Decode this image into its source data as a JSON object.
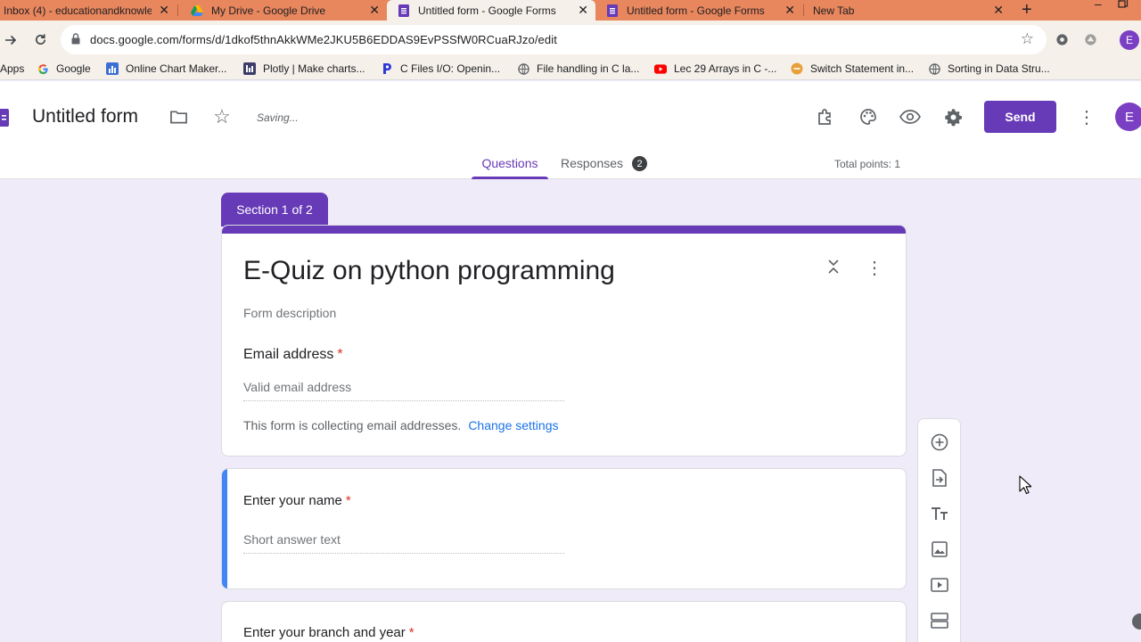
{
  "browser": {
    "tabs": [
      {
        "title": "Inbox (4) - educationandknowle",
        "icon": "gmail-icon"
      },
      {
        "title": "My Drive - Google Drive",
        "icon": "drive-icon"
      },
      {
        "title": "Untitled form - Google Forms",
        "icon": "forms-icon",
        "active": true
      },
      {
        "title": "Untitled form - Google Forms",
        "icon": "forms-icon"
      },
      {
        "title": "New Tab",
        "icon": ""
      }
    ],
    "url": "docs.google.com/forms/d/1dkof5thnAkkWMe2JKU5B6EDDAS9EvPSSfW0RCuaRJzo/edit",
    "bookmarks": [
      {
        "label": "Apps",
        "icon": "apps-grid-icon"
      },
      {
        "label": "Google",
        "icon": "google-icon"
      },
      {
        "label": "Online Chart Maker...",
        "icon": "chart-maker-icon"
      },
      {
        "label": "Plotly | Make charts...",
        "icon": "plotly-icon"
      },
      {
        "label": "C Files I/O: Openin...",
        "icon": "programiz-icon"
      },
      {
        "label": "File handling in C la...",
        "icon": "globe-icon"
      },
      {
        "label": "Lec 29 Arrays in C -...",
        "icon": "youtube-icon"
      },
      {
        "label": "Switch Statement in...",
        "icon": "gfg-icon"
      },
      {
        "label": "Sorting in Data Stru...",
        "icon": "globe-icon"
      }
    ],
    "profile_initial": "E"
  },
  "forms_header": {
    "doc_title": "Untitled form",
    "status": "Saving...",
    "send_label": "Send",
    "avatar_initial": "E",
    "tabs": {
      "questions": "Questions",
      "responses": "Responses",
      "responses_count": "2"
    },
    "total_points": "Total points: 1"
  },
  "section": {
    "tag": "Section 1 of 2",
    "title": "E-Quiz on python programming",
    "description_placeholder": "Form description"
  },
  "email_question": {
    "label": "Email address",
    "required_mark": "*",
    "placeholder": "Valid email address",
    "notice": "This form is collecting email addresses.",
    "notice_link": "Change settings"
  },
  "questions": [
    {
      "label": "Enter your name",
      "required_mark": "*",
      "placeholder": "Short answer text"
    },
    {
      "label": "Enter your branch and year",
      "required_mark": "*"
    }
  ],
  "colors": {
    "accent": "#673ab7",
    "background": "#f0ebf8",
    "tab_strip": "#e8865d",
    "active_question_bar": "#4285f4",
    "required": "#d93025",
    "link": "#1a73e8"
  }
}
